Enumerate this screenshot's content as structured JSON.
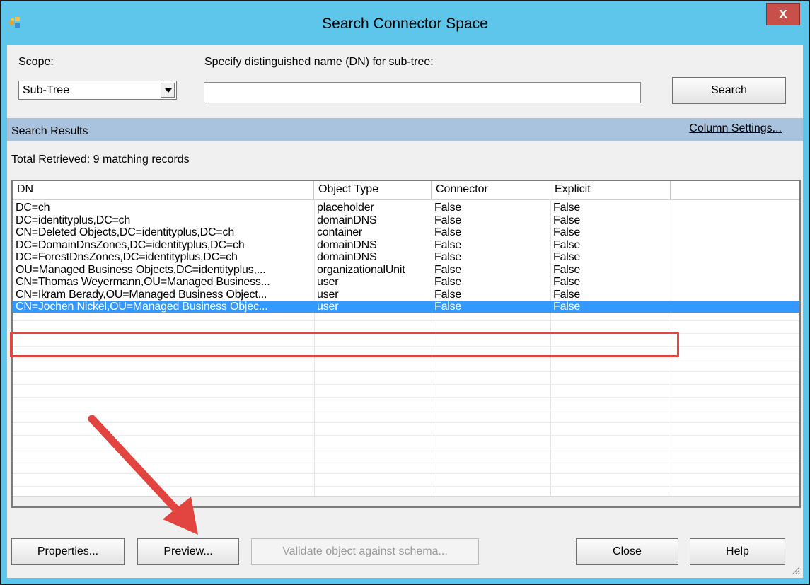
{
  "window": {
    "title": "Search Connector Space",
    "close_glyph": "x"
  },
  "scope": {
    "label": "Scope:",
    "value": "Sub-Tree"
  },
  "dn": {
    "label": "Specify distinguished name (DN) for sub-tree:",
    "value": ""
  },
  "buttons": {
    "search": "Search",
    "properties": "Properties...",
    "preview": "Preview...",
    "validate": "Validate object against schema...",
    "close": "Close",
    "help": "Help"
  },
  "results": {
    "label": "Search Results",
    "column_settings": "Column Settings...",
    "total": "Total Retrieved: 9 matching records"
  },
  "table": {
    "columns": [
      "DN",
      "Object Type",
      "Connector",
      "Explicit"
    ],
    "rows": [
      [
        "DC=ch",
        "placeholder",
        "False",
        "False"
      ],
      [
        "DC=identityplus,DC=ch",
        "domainDNS",
        "False",
        "False"
      ],
      [
        "CN=Deleted Objects,DC=identityplus,DC=ch",
        "container",
        "False",
        "False"
      ],
      [
        "DC=DomainDnsZones,DC=identityplus,DC=ch",
        "domainDNS",
        "False",
        "False"
      ],
      [
        "DC=ForestDnsZones,DC=identityplus,DC=ch",
        "domainDNS",
        "False",
        "False"
      ],
      [
        "OU=Managed Business Objects,DC=identityplus,...",
        "organizationalUnit",
        "False",
        "False"
      ],
      [
        "CN=Thomas Weyermann,OU=Managed Business...",
        "user",
        "False",
        "False"
      ],
      [
        "CN=Ikram Berady,OU=Managed Business Object...",
        "user",
        "False",
        "False"
      ],
      [
        "CN=Jochen Nickel,OU=Managed Business Objec...",
        "user",
        "False",
        "False"
      ]
    ],
    "selected_row": 8
  },
  "colors": {
    "title_bar": "#5dc6ea",
    "selection": "#3399ff",
    "annotation": "#e2453f",
    "results_bar": "#a9c2de"
  },
  "icons": [
    "app-icon",
    "close-icon",
    "dropdown-arrow-icon",
    "resize-grip-icon"
  ]
}
